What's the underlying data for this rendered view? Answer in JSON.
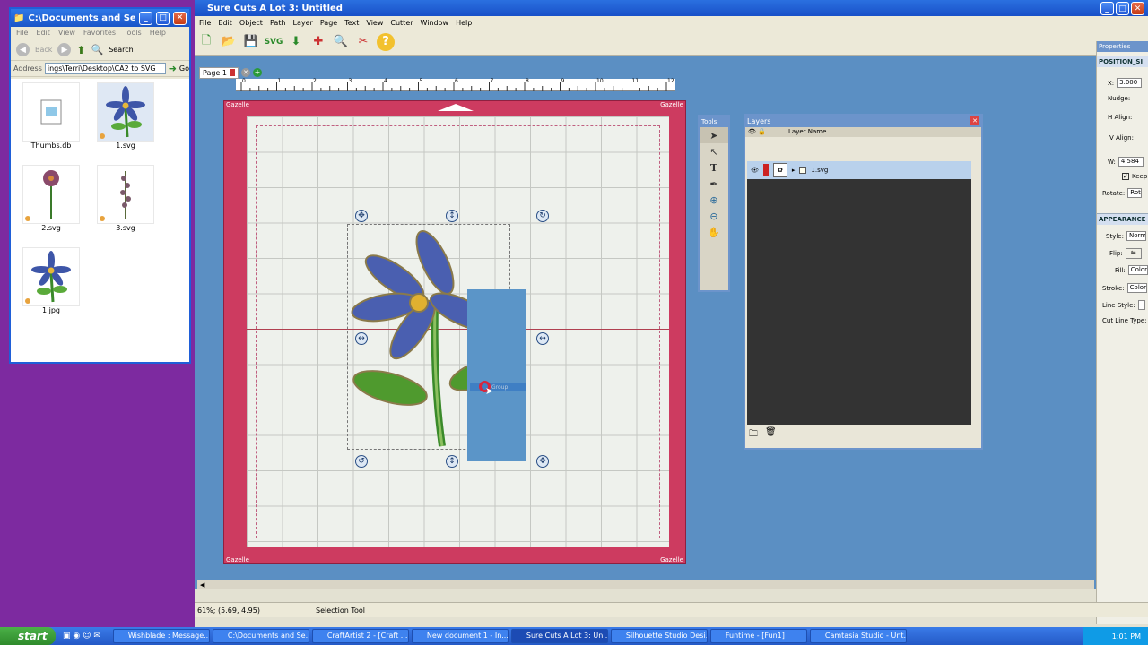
{
  "explorer": {
    "title": "C:\\Documents and Settings\\Te...",
    "menu": [
      "File",
      "Edit",
      "View",
      "Favorites",
      "Tools",
      "Help"
    ],
    "back_label": "Back",
    "search_label": "Search",
    "address_label": "Address",
    "address_value": "ings\\Terri\\Desktop\\CA2 to SVG",
    "go_label": "Go",
    "files": [
      {
        "name": "Thumbs.db"
      },
      {
        "name": "1.svg"
      },
      {
        "name": "2.svg"
      },
      {
        "name": "3.svg"
      },
      {
        "name": "1.jpg"
      }
    ]
  },
  "app": {
    "title": "Sure Cuts A Lot 3: Untitled",
    "menu": [
      "File",
      "Edit",
      "Object",
      "Path",
      "Layer",
      "Page",
      "Text",
      "View",
      "Cutter",
      "Window",
      "Help"
    ],
    "page_tab": "Page 1",
    "ruler_ticks": [
      "0",
      "1",
      "2",
      "3",
      "4",
      "5",
      "6",
      "7",
      "8",
      "9",
      "10",
      "11",
      "12"
    ],
    "mat_label": "Gazelle",
    "selection_label": "Group"
  },
  "tools_panel": {
    "title": "Tools"
  },
  "layers_panel": {
    "title": "Layers",
    "column_header": "Layer Name",
    "layer_item": "1.svg"
  },
  "properties": {
    "title": "Properties",
    "position_section": "POSITION_SI",
    "x_label": "X:",
    "x_value": "3.000",
    "nudge_label": "Nudge:",
    "halign_label": "H Align:",
    "valign_label": "V Align:",
    "w_label": "W:",
    "w_value": "4.584",
    "keep_label": "Keep P",
    "rotate_label": "Rotate:",
    "rotate_value": "Rot",
    "appearance_section": "APPEARANCE",
    "style_label": "Style:",
    "style_value": "Norma",
    "flip_label": "Flip:",
    "fill_label": "Fill:",
    "fill_value": "Color",
    "stroke_label": "Stroke:",
    "stroke_value": "Color",
    "linestyle_label": "Line Style:",
    "cutline_label": "Cut Line Type:"
  },
  "status": {
    "zoom_pos": "61%; (5.69, 4.95)",
    "tool": "Selection Tool"
  },
  "taskbar": {
    "start": "start",
    "tasks": [
      "Wishblade : Message...",
      "C:\\Documents and Se...",
      "CraftArtist 2 - [Craft ...",
      "New document 1 - In...",
      "Sure Cuts A Lot 3: Un...",
      "Silhouette Studio Desi...",
      "Funtime - [Fun1]",
      "Camtasia Studio - Unt..."
    ],
    "clock": "1:01 PM"
  }
}
